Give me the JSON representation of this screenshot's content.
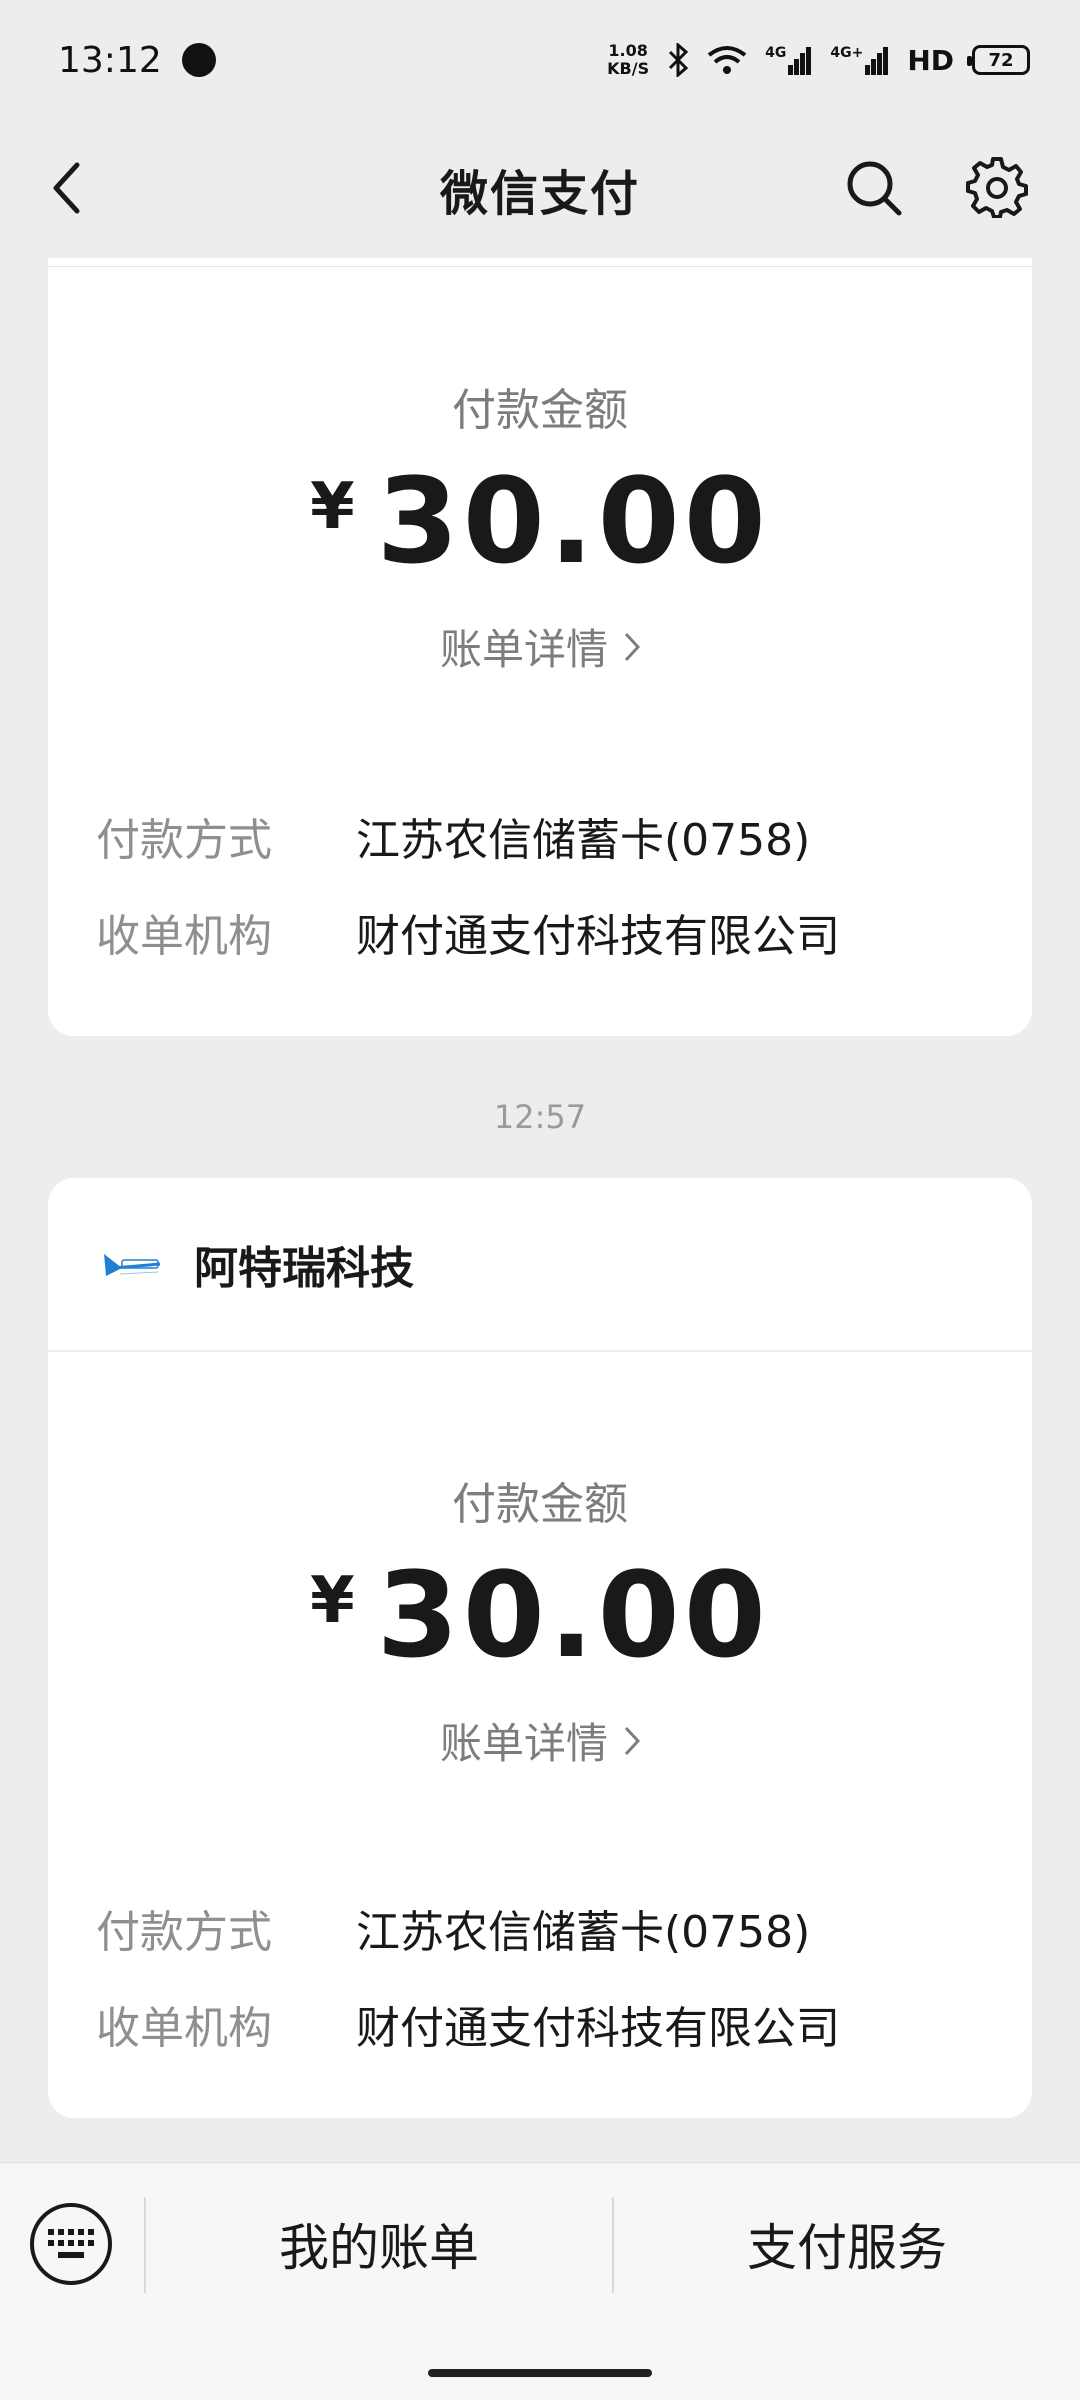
{
  "status_bar": {
    "time": "13:12",
    "net_speed_value": "1.08",
    "net_speed_unit": "KB/S",
    "signal1_label": "4G",
    "signal2_label": "4G+",
    "hd_label": "HD",
    "battery": "72"
  },
  "nav": {
    "title": "微信支付"
  },
  "transactions": [
    {
      "amount_label": "付款金额",
      "currency": "¥",
      "amount": "30.00",
      "detail_link": "账单详情",
      "payment_method_label": "付款方式",
      "payment_method": "江苏农信储蓄卡(0758)",
      "acquirer_label": "收单机构",
      "acquirer": "财付通支付科技有限公司"
    },
    {
      "time": "12:57",
      "merchant": "阿特瑞科技",
      "amount_label": "付款金额",
      "currency": "¥",
      "amount": "30.00",
      "detail_link": "账单详情",
      "payment_method_label": "付款方式",
      "payment_method": "江苏农信储蓄卡(0758)",
      "acquirer_label": "收单机构",
      "acquirer": "财付通支付科技有限公司"
    }
  ],
  "bottom_bar": {
    "tab1": "我的账单",
    "tab2": "支付服务"
  },
  "icons": {
    "back": "chevron-left-icon",
    "search": "search-icon",
    "settings": "gear-icon",
    "keyboard": "keyboard-icon"
  },
  "colors": {
    "background": "#ededed",
    "card": "#ffffff",
    "secondary_text": "#7d7d7d"
  }
}
